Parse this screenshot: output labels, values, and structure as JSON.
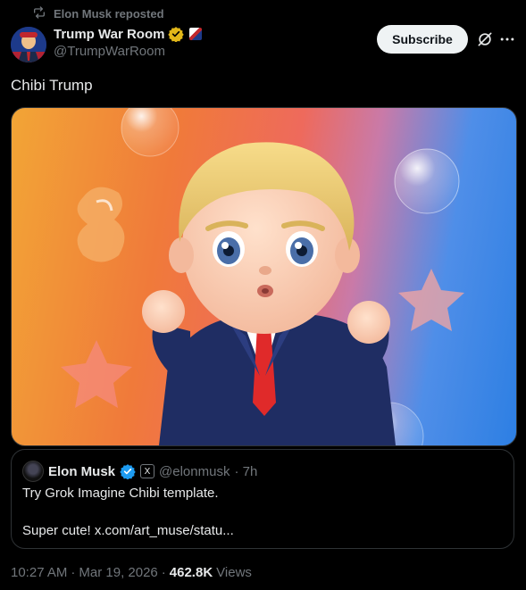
{
  "repost": {
    "text": "Elon Musk reposted"
  },
  "author": {
    "display_name": "Trump War Room",
    "handle": "@TrumpWarRoom"
  },
  "subscribe_label": "Subscribe",
  "post_text": "Chibi Trump",
  "quote": {
    "name": "Elon Musk",
    "x_badge": "X",
    "handle": "@elonmusk",
    "time": "· 7h",
    "line1": "Try Grok Imagine Chibi template.",
    "line2": "Super cute! x.com/art_muse/statu..."
  },
  "meta": {
    "time": "10:27 AM",
    "sep1": "·",
    "date": "Mar 19, 2026",
    "sep2": "·",
    "views_count": "462.8K",
    "views_label": "Views"
  },
  "colors": {
    "verified_gold": "#e2b719",
    "verified_blue": "#1d9bf0",
    "muted_text": "#71767b"
  },
  "icons": [
    "repost-icon",
    "gold-verified-icon",
    "grok-icon",
    "more-icon",
    "blue-verified-icon"
  ]
}
